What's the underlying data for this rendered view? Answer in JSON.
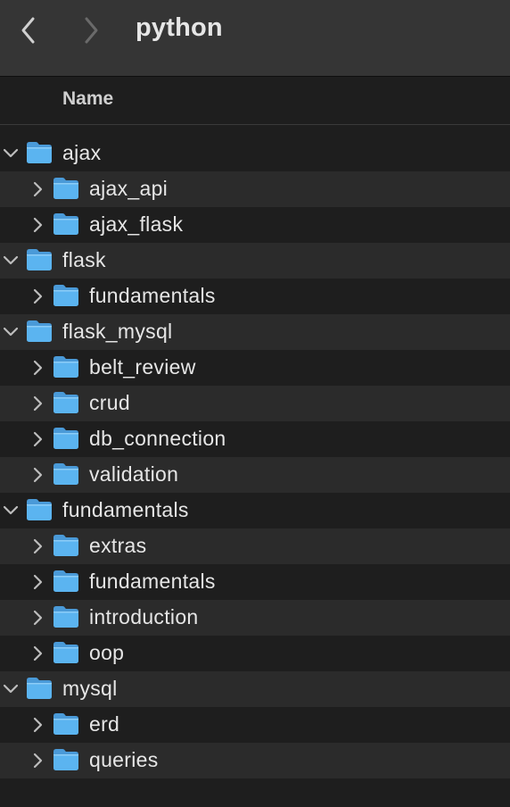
{
  "window": {
    "title": "python",
    "back_icon": "chevron-left-icon",
    "forward_icon": "chevron-right-icon"
  },
  "columns": {
    "name_label": "Name"
  },
  "colors": {
    "toolbar_bg": "#353535",
    "row_alt_bg": "#2b2b2b",
    "background": "#1e1e1e",
    "folder_blue": "#5bb4f0"
  },
  "tree": [
    {
      "name": "ajax",
      "level": 0,
      "expanded": true
    },
    {
      "name": "ajax_api",
      "level": 1,
      "expanded": false
    },
    {
      "name": "ajax_flask",
      "level": 1,
      "expanded": false
    },
    {
      "name": "flask",
      "level": 0,
      "expanded": true
    },
    {
      "name": "fundamentals",
      "level": 1,
      "expanded": false
    },
    {
      "name": "flask_mysql",
      "level": 0,
      "expanded": true
    },
    {
      "name": "belt_review",
      "level": 1,
      "expanded": false
    },
    {
      "name": "crud",
      "level": 1,
      "expanded": false
    },
    {
      "name": "db_connection",
      "level": 1,
      "expanded": false
    },
    {
      "name": "validation",
      "level": 1,
      "expanded": false
    },
    {
      "name": "fundamentals",
      "level": 0,
      "expanded": true
    },
    {
      "name": "extras",
      "level": 1,
      "expanded": false
    },
    {
      "name": "fundamentals",
      "level": 1,
      "expanded": false
    },
    {
      "name": "introduction",
      "level": 1,
      "expanded": false
    },
    {
      "name": "oop",
      "level": 1,
      "expanded": false
    },
    {
      "name": "mysql",
      "level": 0,
      "expanded": true
    },
    {
      "name": "erd",
      "level": 1,
      "expanded": false
    },
    {
      "name": "queries",
      "level": 1,
      "expanded": false
    }
  ]
}
